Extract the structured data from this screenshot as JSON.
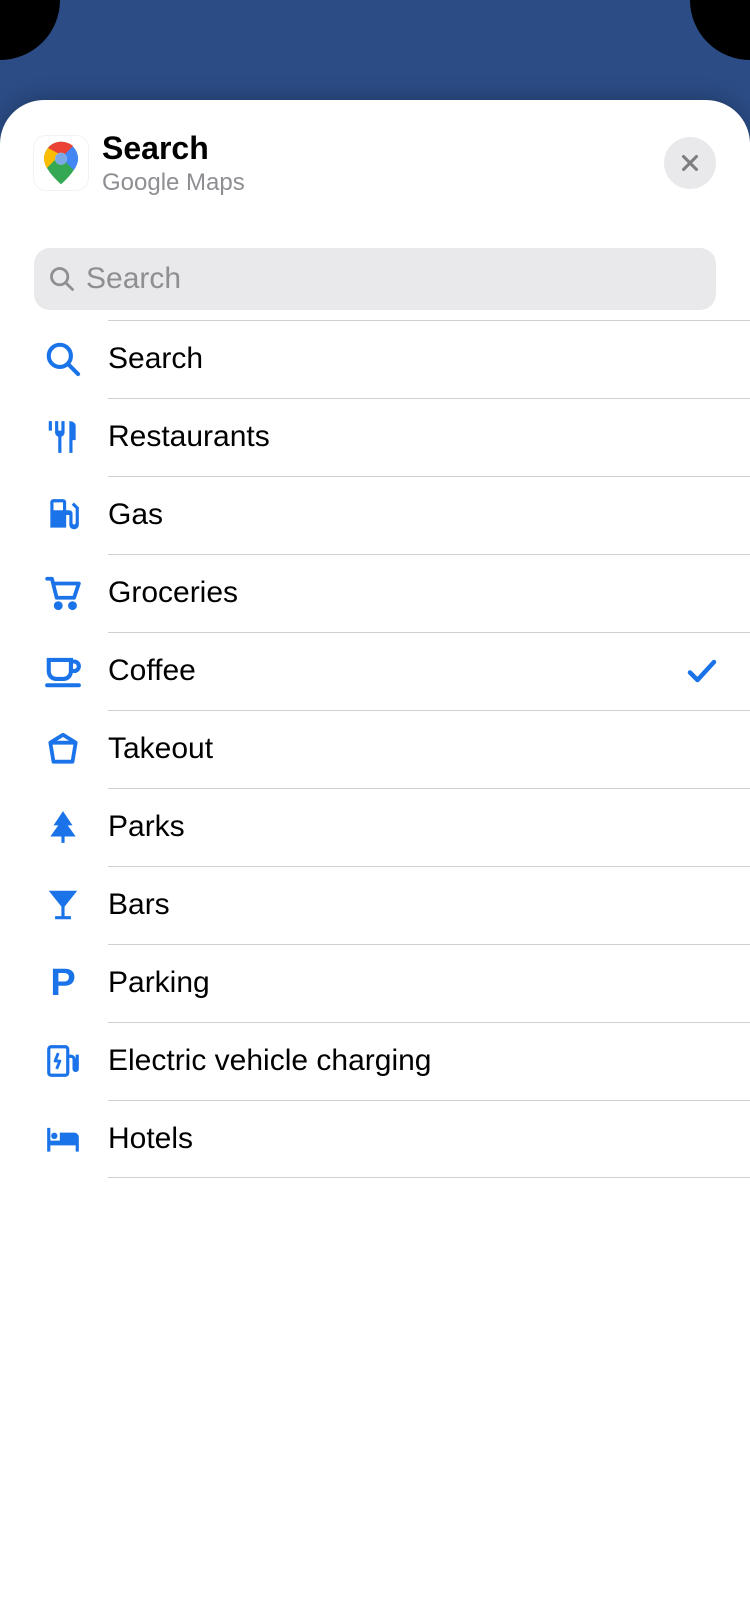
{
  "header": {
    "title": "Search",
    "subtitle": "Google Maps"
  },
  "search": {
    "placeholder": "Search",
    "value": ""
  },
  "categories": [
    {
      "icon": "search",
      "label": "Search",
      "selected": false
    },
    {
      "icon": "restaurant",
      "label": "Restaurants",
      "selected": false
    },
    {
      "icon": "gas",
      "label": "Gas",
      "selected": false
    },
    {
      "icon": "groceries",
      "label": "Groceries",
      "selected": false
    },
    {
      "icon": "coffee",
      "label": "Coffee",
      "selected": true
    },
    {
      "icon": "takeout",
      "label": "Takeout",
      "selected": false
    },
    {
      "icon": "parks",
      "label": "Parks",
      "selected": false
    },
    {
      "icon": "bars",
      "label": "Bars",
      "selected": false
    },
    {
      "icon": "parking",
      "label": "Parking",
      "selected": false
    },
    {
      "icon": "ev",
      "label": "Electric vehicle charging",
      "selected": false
    },
    {
      "icon": "hotels",
      "label": "Hotels",
      "selected": false
    }
  ],
  "colors": {
    "accent": "#1a73e8"
  }
}
